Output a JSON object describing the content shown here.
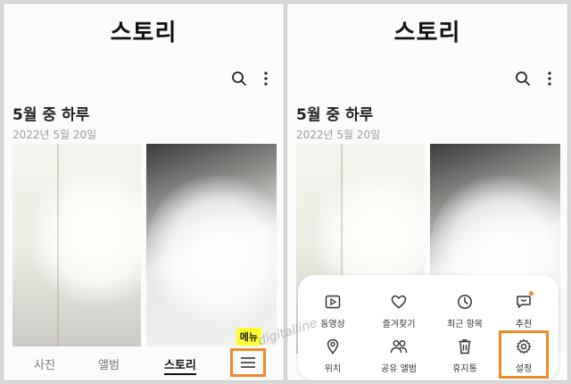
{
  "app_title": "스토리",
  "story": {
    "title": "5월 중 하루",
    "date": "2022년 5월 20일"
  },
  "icons": {
    "search": "search-icon",
    "more": "more-vert-icon",
    "menu": "hamburger-menu-icon"
  },
  "bottom_nav": {
    "tabs": [
      "사진",
      "앨범",
      "스토리"
    ],
    "active": "스토리"
  },
  "menu_badge": "메뉴",
  "menu_items": [
    {
      "label": "동영상",
      "icon": "video-icon"
    },
    {
      "label": "즐겨찾기",
      "icon": "heart-icon"
    },
    {
      "label": "최근 항목",
      "icon": "clock-icon"
    },
    {
      "label": "추천",
      "icon": "suggestion-icon"
    },
    {
      "label": "위치",
      "icon": "location-pin-icon"
    },
    {
      "label": "공유 앨범",
      "icon": "shared-people-icon"
    },
    {
      "label": "휴지통",
      "icon": "trash-icon"
    },
    {
      "label": "설정",
      "icon": "gear-icon"
    }
  ],
  "watermark": "digitalline",
  "colors": {
    "highlight": "#f08a24",
    "badge": "#ffff33",
    "notification_dot": "#f08a24"
  }
}
